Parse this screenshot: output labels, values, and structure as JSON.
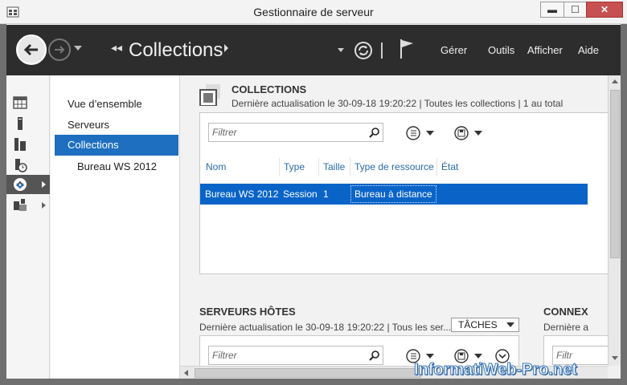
{
  "window": {
    "title": "Gestionnaire de serveur",
    "buttons": {
      "minimize": "▬",
      "maximize": "☐",
      "close": "✕"
    }
  },
  "header": {
    "breadcrumb_arrows": "◂◂",
    "title": "Collections",
    "menu": {
      "gerer": "Gérer",
      "outils": "Outils",
      "afficher": "Afficher",
      "aide": "Aide"
    }
  },
  "rail": {
    "items": [
      "dashboard-icon",
      "server-icon",
      "servers-icon",
      "file-storage-icon",
      "remote-desktop-icon",
      "storage-services-icon"
    ],
    "selected_index": 4
  },
  "nav": {
    "items": [
      {
        "label": "Vue d’ensemble",
        "selected": false
      },
      {
        "label": "Serveurs",
        "selected": false
      },
      {
        "label": "Collections",
        "selected": true
      },
      {
        "label": "Bureau WS 2012",
        "selected": false,
        "sub": true
      }
    ]
  },
  "collections": {
    "title": "COLLECTIONS",
    "subtitle": "Dernière actualisation le 30-09-18 19:20:22 | Toutes les collections | 1 au total",
    "filter_placeholder": "Filtrer",
    "columns": [
      "Nom",
      "Type",
      "Taille",
      "Type de ressource",
      "État"
    ],
    "rows": [
      {
        "nom": "Bureau WS 2012",
        "type": "Session",
        "taille": "1",
        "ressource": "Bureau à distance",
        "etat": ""
      }
    ]
  },
  "hosts": {
    "title": "SERVEURS HÔTES",
    "subtitle": "Dernière actualisation le 30-09-18 19:20:22 | Tous les ser...",
    "tasks_label": "TÂCHES",
    "filter_placeholder": "Filtrer"
  },
  "connections": {
    "title": "CONNEX",
    "subtitle": "Dernière a",
    "filter_placeholder": "Filtr"
  },
  "watermark": "InformatiWeb-Pro.net",
  "colors": {
    "accent": "#1e6fbf",
    "selected_row": "#0a64c8",
    "header_bg": "#2d2d2d"
  }
}
